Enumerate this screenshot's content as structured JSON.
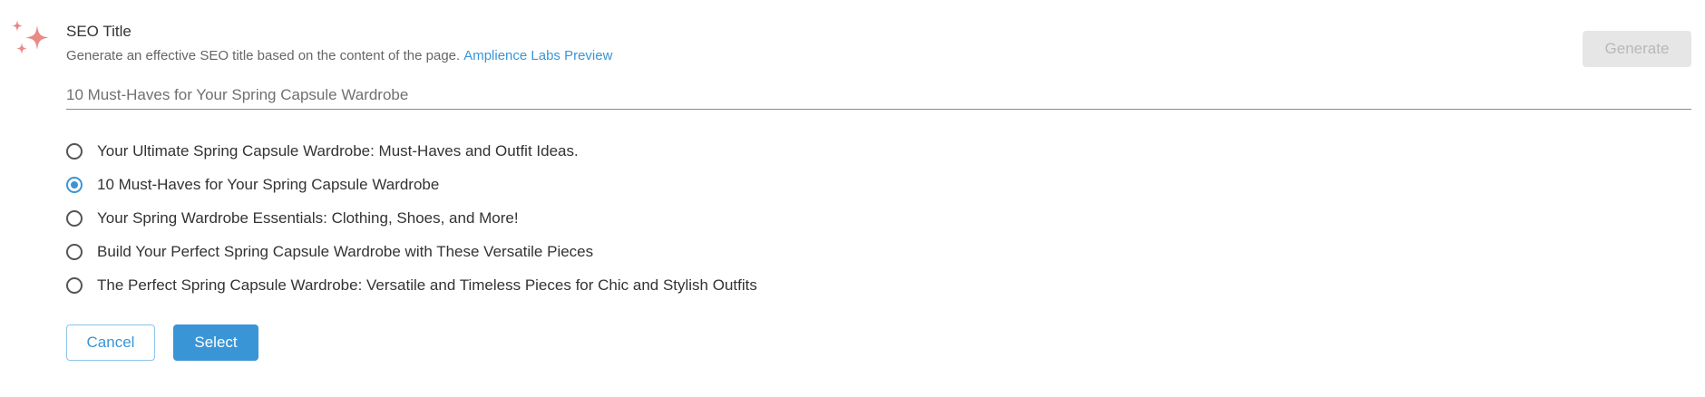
{
  "header": {
    "icon": "sparkle-icon",
    "title": "SEO Title",
    "description": "Generate an effective SEO title based on the content of the page.",
    "link_label": "Amplience Labs Preview",
    "generate_label": "Generate"
  },
  "field": {
    "value": "10 Must-Haves for Your Spring Capsule Wardrobe"
  },
  "options": [
    {
      "label": "Your Ultimate Spring Capsule Wardrobe: Must-Haves and Outfit Ideas.",
      "selected": false
    },
    {
      "label": "10 Must-Haves for Your Spring Capsule Wardrobe",
      "selected": true
    },
    {
      "label": "Your Spring Wardrobe Essentials: Clothing, Shoes, and More!",
      "selected": false
    },
    {
      "label": "Build Your Perfect Spring Capsule Wardrobe with These Versatile Pieces",
      "selected": false
    },
    {
      "label": "The Perfect Spring Capsule Wardrobe: Versatile and Timeless Pieces for Chic and Stylish Outfits",
      "selected": false
    }
  ],
  "actions": {
    "cancel_label": "Cancel",
    "select_label": "Select"
  },
  "colors": {
    "accent": "#3a95d6",
    "sparkle": "#e98a86",
    "disabled_bg": "#e6e6e6",
    "disabled_text": "#b8b8b8"
  }
}
